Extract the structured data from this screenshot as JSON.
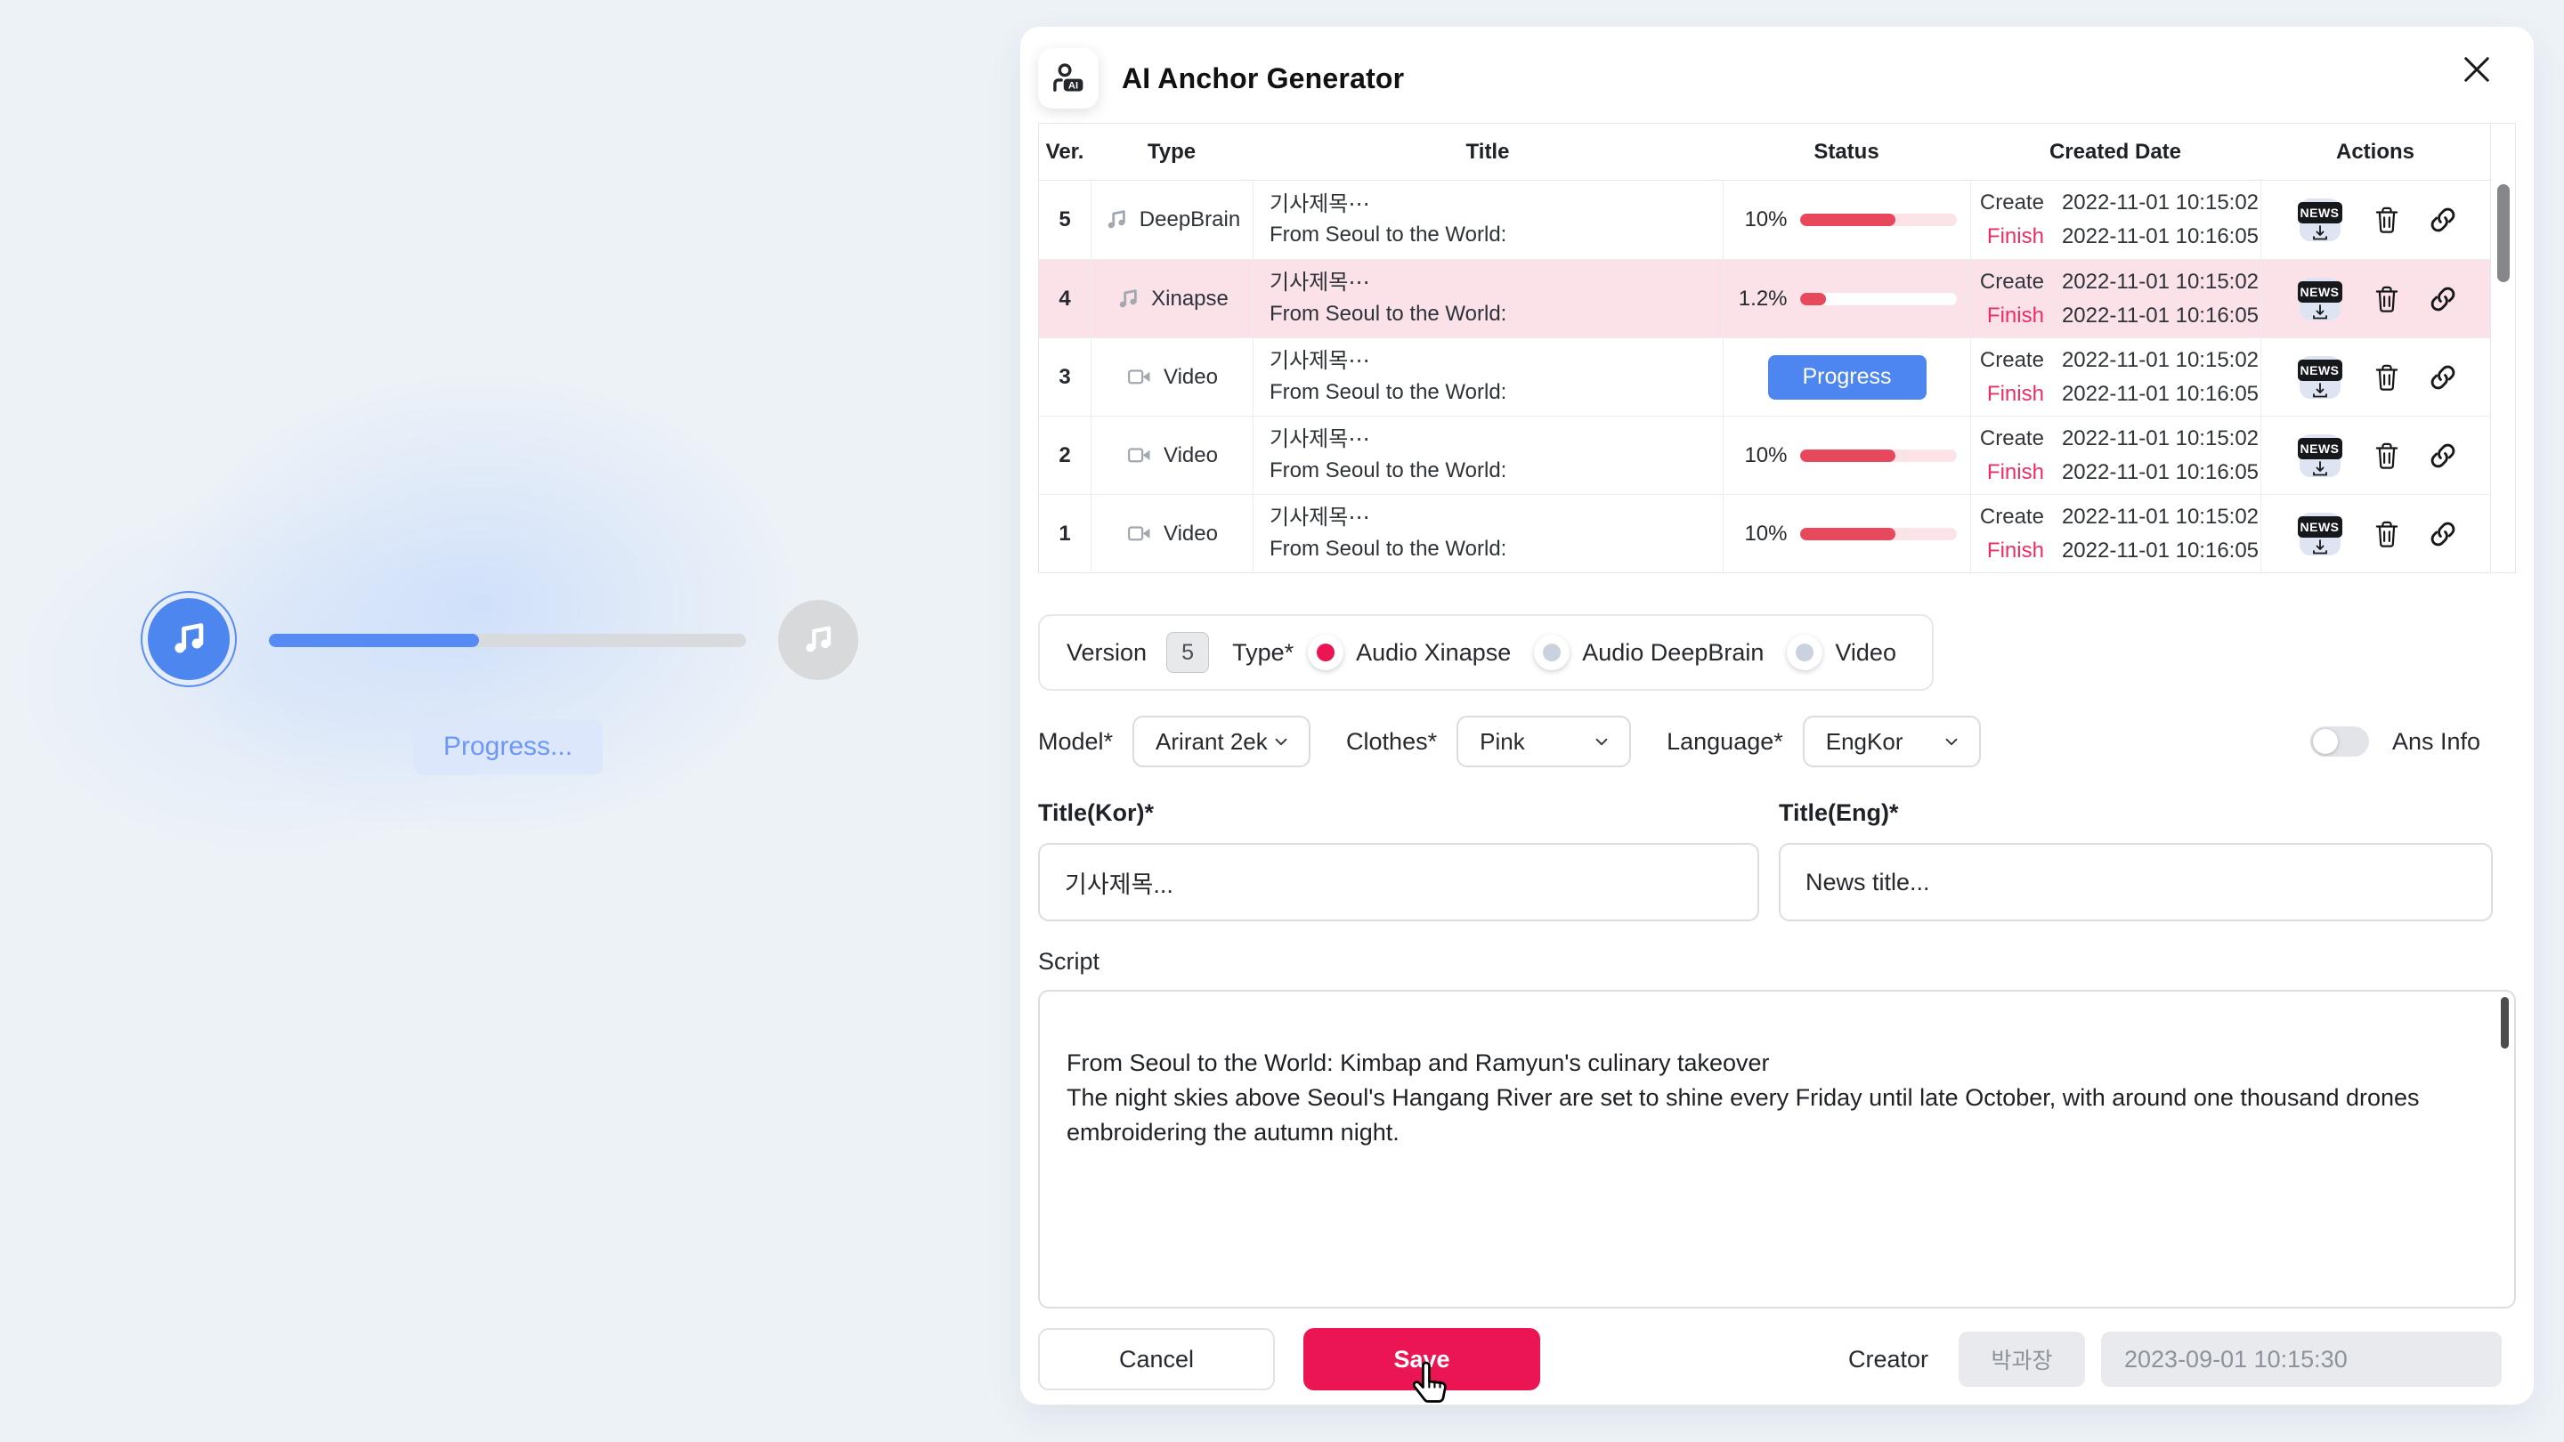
{
  "player": {
    "progress_label": "Progress...",
    "progress_percent": 44
  },
  "dialog": {
    "title": "AI Anchor Generator",
    "app_icon_text": "AI"
  },
  "table": {
    "headers": [
      "Ver.",
      "Type",
      "Title",
      "Status",
      "Created Date",
      "Actions"
    ],
    "rows": [
      {
        "ver": "5",
        "type": "DeepBrain",
        "title_line1": "기사제목⋯",
        "title_line2": "From Seoul to the World:",
        "status_label": "10%",
        "status_fill": 61,
        "created_label": "Create",
        "created_at": "2022-11-01  10:15:02",
        "finish_label": "Finish",
        "finish_at": "2022-11-01  10:16:05"
      },
      {
        "ver": "4",
        "type": "Xinapse",
        "title_line1": "기사제목⋯",
        "title_line2": "From Seoul to the World:",
        "status_label": "1.2%",
        "status_fill": 17,
        "created_label": "Create",
        "created_at": "2022-11-01  10:15:02",
        "finish_label": "Finish",
        "finish_at": "2022-11-01  10:16:05"
      },
      {
        "ver": "3",
        "type": "Video",
        "title_line1": "기사제목⋯",
        "title_line2": "From Seoul to the World:",
        "status_button": "Progress",
        "created_label": "Create",
        "created_at": "2022-11-01  10:15:02",
        "finish_label": "Finish",
        "finish_at": "2022-11-01  10:16:05"
      },
      {
        "ver": "2",
        "type": "Video",
        "title_line1": "기사제목⋯",
        "title_line2": "From Seoul to the World:",
        "status_label": "10%",
        "status_fill": 61,
        "created_label": "Create",
        "created_at": "2022-11-01  10:15:02",
        "finish_label": "Finish",
        "finish_at": "2022-11-01  10:16:05"
      },
      {
        "ver": "1",
        "type": "Video",
        "title_line1": "기사제목⋯",
        "title_line2": "From Seoul to the World:",
        "status_label": "10%",
        "status_fill": 61,
        "created_label": "Create",
        "created_at": "2022-11-01  10:15:02",
        "finish_label": "Finish",
        "finish_at": "2022-11-01  10:16:05"
      }
    ]
  },
  "form": {
    "version_label": "Version",
    "version_value": "5",
    "type_label": "Type*",
    "type_options": [
      {
        "label": "Audio Xinapse",
        "selected": true
      },
      {
        "label": "Audio DeepBrain",
        "selected": false
      },
      {
        "label": "Video",
        "selected": false
      }
    ],
    "model_label": "Model*",
    "model_value": "Arirant 2ek",
    "clothes_label": "Clothes*",
    "clothes_value": "Pink",
    "language_label": "Language*",
    "language_value": "EngKor",
    "ans_info_label": "Ans Info",
    "ans_info_on": false,
    "title_kor_label": "Title(Kor)*",
    "title_kor_value": "기사제목...",
    "title_eng_label": "Title(Eng)*",
    "title_eng_value": "News title...",
    "script_label": "Script",
    "script_value": "From Seoul to the World: Kimbap and Ramyun's culinary takeover\nThe night skies above Seoul's Hangang River are set to shine every Friday until late October, with around one thousand drones embroidering the autumn night."
  },
  "footer": {
    "cancel_label": "Cancel",
    "save_label": "Save",
    "creator_label": "Creator",
    "creator_value": "박과장",
    "created_at": "2023-09-01 10:15:30"
  },
  "colors": {
    "accent_crimson": "#EC1553",
    "accent_blue": "#4D86F0",
    "finish_text": "#EC2D64",
    "bar_red": "#E8485C",
    "bar_track_pink": "#FBE3E8",
    "selected_row_bg": "#FAE2E8",
    "page_bg": "#EDF2F7"
  }
}
